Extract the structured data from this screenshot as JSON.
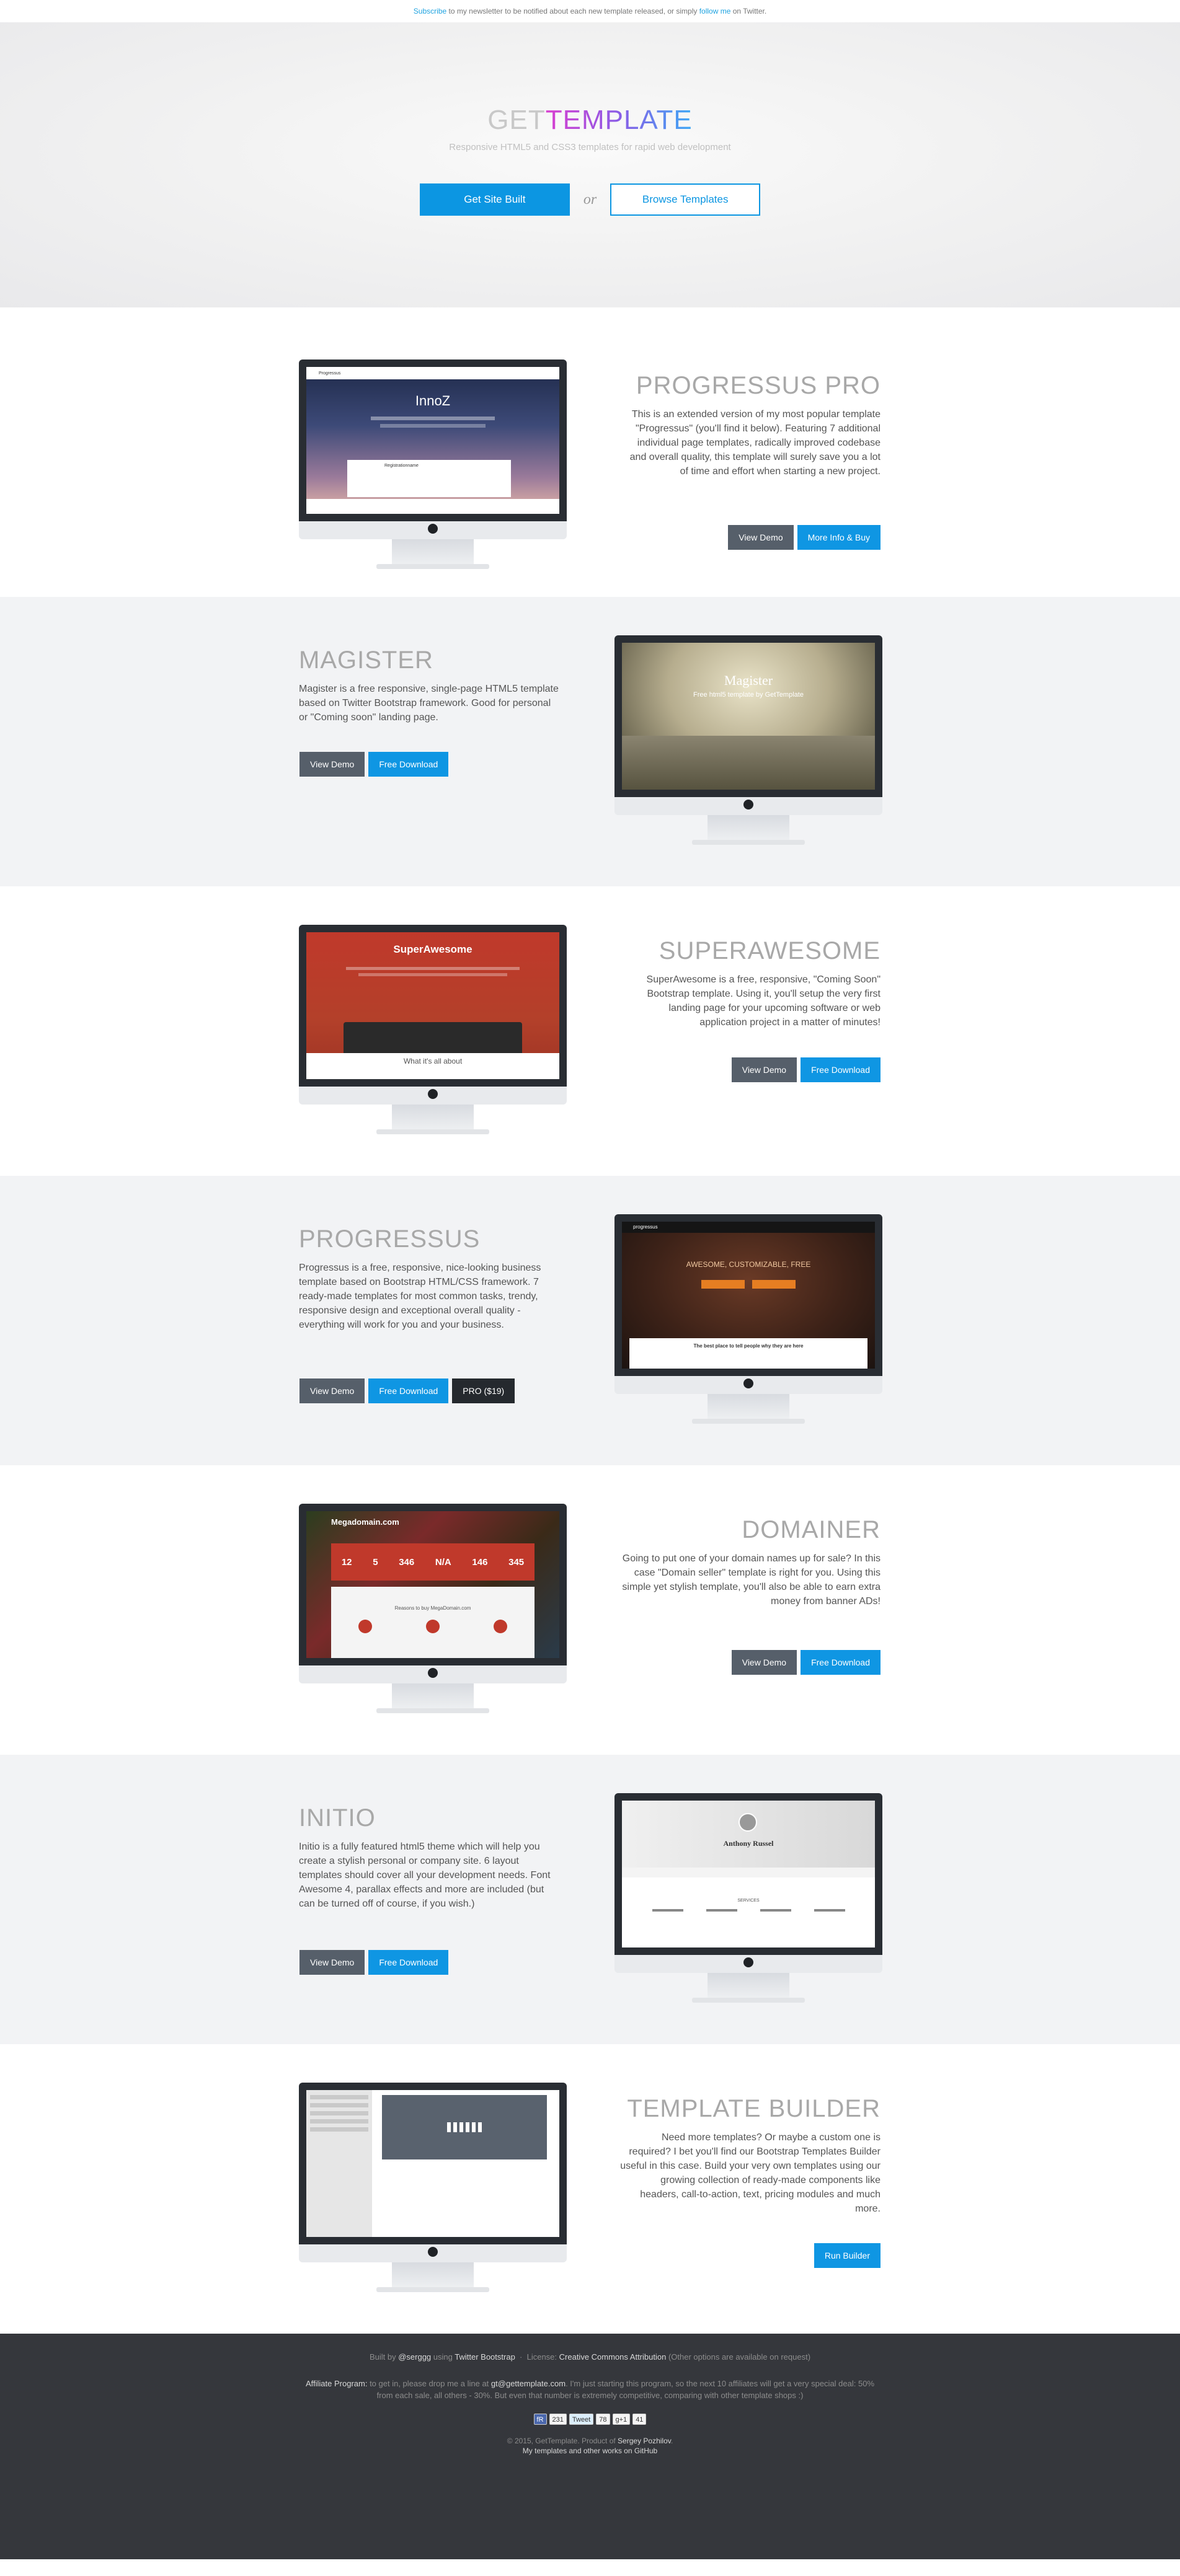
{
  "topbar": {
    "subscribe": "Subscribe",
    "middle": " to my newsletter to be notified about each new template released, or simply ",
    "follow": "follow me",
    "end": " on Twitter."
  },
  "hero": {
    "logo_get": "GET",
    "logo_template": "TEMPLATE",
    "tagline": "Responsive HTML5 and CSS3 templates for rapid web development",
    "cta_primary": "Get Site Built",
    "or": "or",
    "cta_secondary": "Browse Templates"
  },
  "templates": [
    {
      "title": "PROGRESSUS PRO",
      "description": "This is an extended version of my most popular template \"Progressus\" (you'll find it below). Featuring 7 additional individual page templates, radically improved codebase and overall quality, this template will surely save you a lot of time and effort when starting a new project.",
      "buttons": [
        "View Demo",
        "More Info & Buy"
      ],
      "preview": {
        "brand": "Progressus",
        "heading": "InnoZ",
        "card": "Registrationname"
      }
    },
    {
      "title": "MAGISTER",
      "description": "Magister is a free responsive, single-page HTML5 template based on Twitter Bootstrap framework. Good for personal or \"Coming soon\" landing page.",
      "buttons": [
        "View Demo",
        "Free Download"
      ],
      "preview": {
        "heading": "Magister",
        "sub": "Free html5 template by GetTemplate"
      }
    },
    {
      "title": "SUPERAWESOME",
      "description": "SuperAwesome is a free, responsive, \"Coming Soon\" Bootstrap template. Using it, you'll setup the very first landing page for your upcoming software or web application project in a matter of minutes!",
      "buttons": [
        "View Demo",
        "Free Download"
      ],
      "preview": {
        "heading": "SuperAwesome",
        "bottom": "What it's all about"
      }
    },
    {
      "title": "PROGRESSUS",
      "description": "Progressus is a free, responsive, nice-looking business template based on Bootstrap HTML/CSS framework. 7 ready-made templates for most common tasks, trendy, responsive design and exceptional overall quality - everything will work for you and your business.",
      "buttons": [
        "View Demo",
        "Free Download",
        "PRO ($19)"
      ],
      "preview": {
        "brand": "progressus",
        "heading": "AWESOME, CUSTOMIZABLE, FREE",
        "bottom": "The best place to tell people why they are here"
      }
    },
    {
      "title": "DOMAINER",
      "description": "Going to put one of your domain names up for sale? In this case \"Domain seller\" template is right for you. Using this simple yet stylish template, you'll also be able to earn extra money from banner ADs!",
      "buttons": [
        "View Demo",
        "Free Download"
      ],
      "preview": {
        "heading": "Megadomain.com",
        "stats": [
          "12",
          "5",
          "346",
          "N/A",
          "146",
          "345"
        ],
        "reasons": "Reasons to buy MegaDomain.com"
      }
    },
    {
      "title": "INITIO",
      "description": "Initio is a fully featured html5 theme which will help you create a stylish personal or company site. 6 layout templates should cover all your development needs. Font Awesome 4, parallax effects and more are included (but can be turned off of course, if you wish.)",
      "buttons": [
        "View Demo",
        "Free Download"
      ],
      "preview": {
        "heading": "Anthony Russel",
        "services": "SERVICES"
      }
    },
    {
      "title": "TEMPLATE BUILDER",
      "description": "Need more templates? Or maybe a custom one is required? I bet you'll find our Bootstrap Templates Builder useful in this case. Build your very own templates using our growing collection of ready-made components like headers, call-to-action, text, pricing modules and much more.",
      "buttons": [
        "Run Builder"
      ],
      "preview": {}
    }
  ],
  "footer": {
    "built_by": "Built by",
    "author_handle": "@serggg",
    "using": "using",
    "bootstrap": "Twitter Bootstrap",
    "license_label": "License:",
    "license": "Creative Commons Attribution",
    "license_note": "(Other options are available on request)",
    "affiliate_label": "Affiliate Program:",
    "affiliate_a": " to get in, please drop me a line at ",
    "affiliate_email": "gt@gettemplate.com",
    "affiliate_b": ". I'm just starting this program, so the next 10 affiliates will get a very special deal: 50% from each sale, all others - 30%. But even that number is extremely competitive, comparing with other template shops :)",
    "social": {
      "fb": "fR",
      "fb_count": "231",
      "tweet": "Tweet",
      "tweet_count": "78",
      "gplus": "g+1",
      "gplus_count": "41"
    },
    "copyright": "© 2015, GetTemplate. Product of",
    "author_name": "Sergey Pozhilov",
    "github": "My templates and other works on GitHub"
  },
  "colors": {
    "accent": "#0f96e3",
    "dark_button": "#565f6a",
    "footer_bg": "#35373c"
  }
}
